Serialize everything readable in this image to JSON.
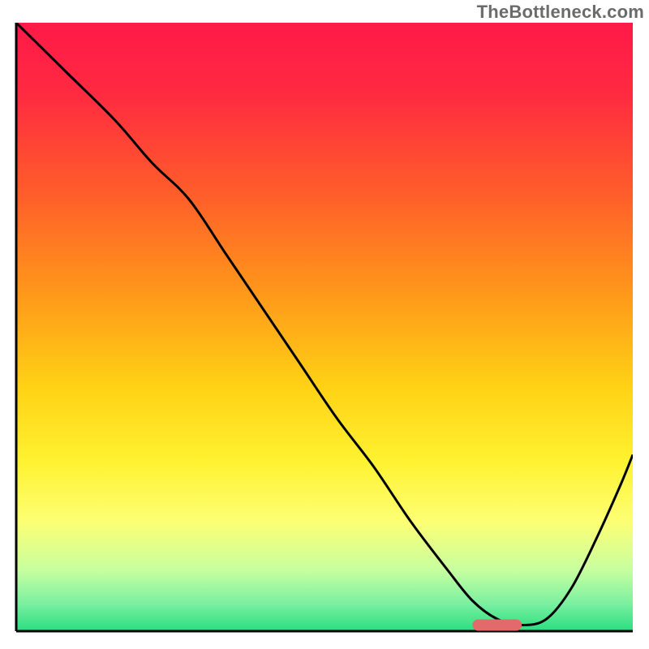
{
  "watermark": "TheBottleneck.com",
  "chart_data": {
    "type": "line",
    "title": "",
    "xlabel": "",
    "ylabel": "",
    "xlim": [
      0,
      100
    ],
    "ylim": [
      0,
      100
    ],
    "grid": false,
    "legend": false,
    "background_gradient": [
      {
        "pos": 0.0,
        "color": "#ff1948"
      },
      {
        "pos": 0.12,
        "color": "#ff2b40"
      },
      {
        "pos": 0.28,
        "color": "#ff5d2a"
      },
      {
        "pos": 0.45,
        "color": "#ff9a1a"
      },
      {
        "pos": 0.6,
        "color": "#ffd215"
      },
      {
        "pos": 0.72,
        "color": "#fff230"
      },
      {
        "pos": 0.82,
        "color": "#fdff74"
      },
      {
        "pos": 0.9,
        "color": "#c7ffa0"
      },
      {
        "pos": 0.955,
        "color": "#7af0a0"
      },
      {
        "pos": 1.0,
        "color": "#2ade80"
      }
    ],
    "series": [
      {
        "name": "bottleneck-curve",
        "color": "#000000",
        "x": [
          0,
          8,
          16,
          22,
          28,
          34,
          40,
          46,
          52,
          58,
          64,
          70,
          74,
          78,
          82,
          86,
          90,
          94,
          98,
          100
        ],
        "y": [
          100,
          92,
          84,
          77,
          71,
          62,
          53,
          44,
          35,
          27,
          18,
          10,
          5,
          2,
          1,
          2,
          7,
          15,
          24,
          29
        ]
      }
    ],
    "marker": {
      "name": "optimal-range",
      "x_start": 74,
      "x_end": 82,
      "y": 1,
      "color": "#e36a6a"
    }
  },
  "colors": {
    "curve": "#000000",
    "axis": "#000000",
    "marker": "#e36a6a",
    "watermark": "#6b6b6b"
  }
}
